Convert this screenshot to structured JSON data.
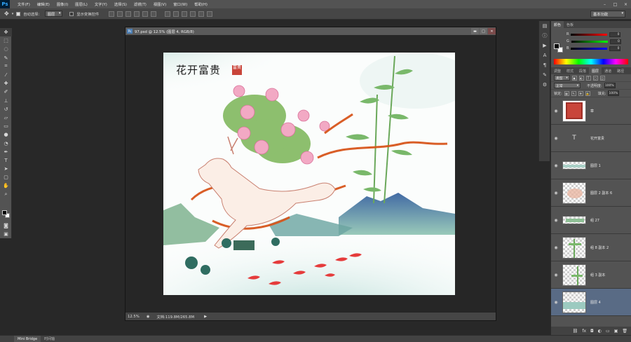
{
  "app": {
    "logo": "Ps",
    "menus": [
      "文件(F)",
      "编辑(E)",
      "图像(I)",
      "图层(L)",
      "文字(Y)",
      "选择(S)",
      "滤镜(T)",
      "视图(V)",
      "窗口(W)",
      "帮助(H)"
    ],
    "window_controls": [
      "–",
      "□",
      "×"
    ]
  },
  "options_bar": {
    "auto_select_label": "自动选择：",
    "auto_select_value": "图层",
    "show_transform_label": "显示变换控件",
    "workspace": "基本功能"
  },
  "tools": [
    "move-icon",
    "marquee-icon",
    "lasso-icon",
    "quick-select-icon",
    "crop-icon",
    "eyedropper-icon",
    "healing-icon",
    "brush-icon",
    "stamp-icon",
    "history-brush-icon",
    "eraser-icon",
    "gradient-icon",
    "blur-icon",
    "dodge-icon",
    "pen-icon",
    "type-icon",
    "path-select-icon",
    "shape-icon",
    "hand-icon",
    "zoom-icon"
  ],
  "document": {
    "title": "97.psd @ 12.5% (图层 4, RGB/8)",
    "zoom": "12.5%",
    "doc_size": "文档:119.8M/265.8M",
    "doc_controls": [
      "▬",
      "□",
      "✕"
    ],
    "artwork_title": "花开富贵",
    "seal_text": "富貴"
  },
  "color_panel": {
    "tabs": [
      "颜色",
      "色板"
    ],
    "channels": [
      {
        "label": "R",
        "value": "0"
      },
      {
        "label": "G",
        "value": "0"
      },
      {
        "label": "B",
        "value": "0"
      }
    ]
  },
  "layers_panel": {
    "tabs": [
      "调整",
      "样式",
      "段落",
      "图层",
      "通道",
      "路径"
    ],
    "active_tab": "图层",
    "filter_label": "类型",
    "blend_mode": "正常",
    "opacity_label": "不透明度:",
    "opacity_value": "100%",
    "lock_label": "锁定:",
    "fill_label": "填充:",
    "fill_value": "100%",
    "layers": [
      {
        "name": "章",
        "kind": "seal"
      },
      {
        "name": "花开富贵",
        "kind": "text"
      },
      {
        "name": "图层 1",
        "kind": "wide"
      },
      {
        "name": "图层 2 副本 6",
        "kind": "flower"
      },
      {
        "name": "组 27",
        "kind": "wide"
      },
      {
        "name": "组 8 副本 2",
        "kind": "bamboo"
      },
      {
        "name": "组 3 副本",
        "kind": "bamboo"
      },
      {
        "name": "图层 4",
        "kind": "landscape",
        "selected": true
      }
    ]
  },
  "bottom_tabs": [
    "Mini Bridge",
    "时间轴"
  ]
}
